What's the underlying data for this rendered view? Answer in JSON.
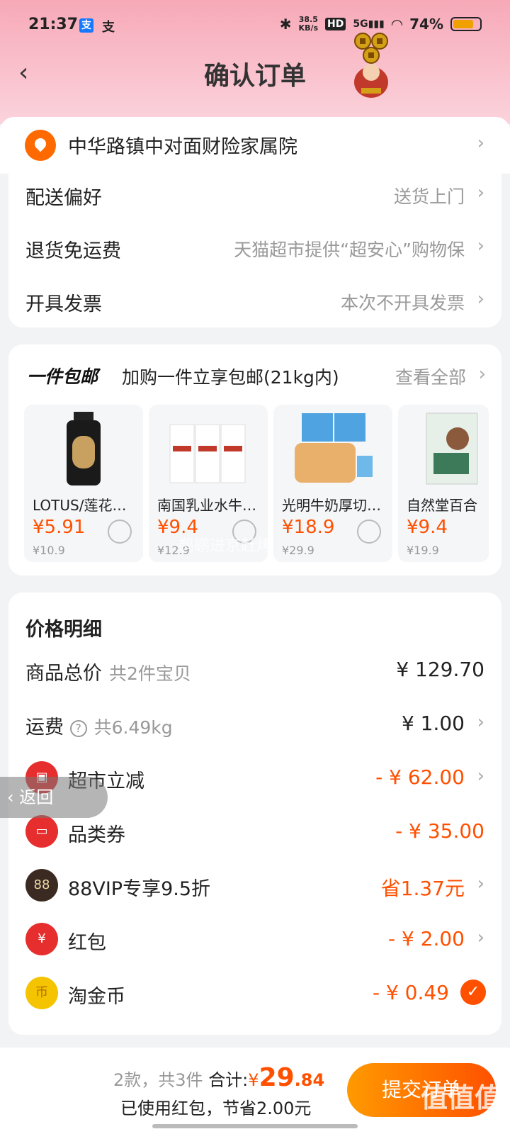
{
  "status_bar": {
    "time": "21:37",
    "alipay_icon_text": "支",
    "alipay_outline_text": "支",
    "speed": "38.5",
    "speed_unit": "KB/s",
    "hd": "HD",
    "network": "5G",
    "battery": "74%"
  },
  "nav": {
    "title": "确认订单"
  },
  "address": {
    "text": "中华路镇中对面财险家属院"
  },
  "options": [
    {
      "label": "配送偏好",
      "value": "送货上门"
    },
    {
      "label": "退货免运费",
      "value": "天猫超市提供“超安心”购物保"
    },
    {
      "label": "开具发票",
      "value": "本次不开具发票"
    }
  ],
  "promo": {
    "title": "一件包邮",
    "subtitle": "加购一件立享包邮(21kg内)",
    "view_all": "查看全部",
    "products": [
      {
        "name": "LOTUS/莲花…",
        "price": "¥5.91",
        "orig": "¥10.9"
      },
      {
        "name": "南国乳业水牛…",
        "price": "¥9.4",
        "orig": "¥12.9"
      },
      {
        "name": "光明牛奶厚切…",
        "price": "¥18.9",
        "orig": "¥29.9"
      },
      {
        "name": "自然堂百合",
        "price": "¥9.4",
        "orig": "¥19.9"
      }
    ],
    "watermark": "鹈鹕进京赶烤"
  },
  "price_detail": {
    "title": "价格明细",
    "rows": [
      {
        "label": "商品总价",
        "sub": "共2件宝贝",
        "value": "¥ 129.70"
      },
      {
        "label": "运费",
        "sub": "共6.49kg",
        "value": "¥ 1.00"
      },
      {
        "label": "超市立减",
        "value": "- ¥ 62.00"
      },
      {
        "label": "品类券",
        "value": "- ¥ 35.00"
      },
      {
        "label": "88VIP专享9.5折",
        "value": "省1.37元",
        "icon_text": "88"
      },
      {
        "label": "红包",
        "value": "- ¥ 2.00",
        "icon_text": "¥"
      },
      {
        "label": "淘金币",
        "value": "- ¥ 0.49",
        "icon_text": "币"
      }
    ]
  },
  "float_back": {
    "label": "返回"
  },
  "bottom_bar": {
    "count": "2款，共3件",
    "total_label": "合计:",
    "currency": "¥",
    "total_int": "29",
    "total_dec": ".84",
    "saving": "已使用红包，节省2.00元",
    "submit": "提交订单",
    "logo": "值值值",
    "logo_url": "zhizhizhi.com"
  },
  "colors": {
    "accent": "#ff5000",
    "header_pink": "#f7a9b8"
  }
}
